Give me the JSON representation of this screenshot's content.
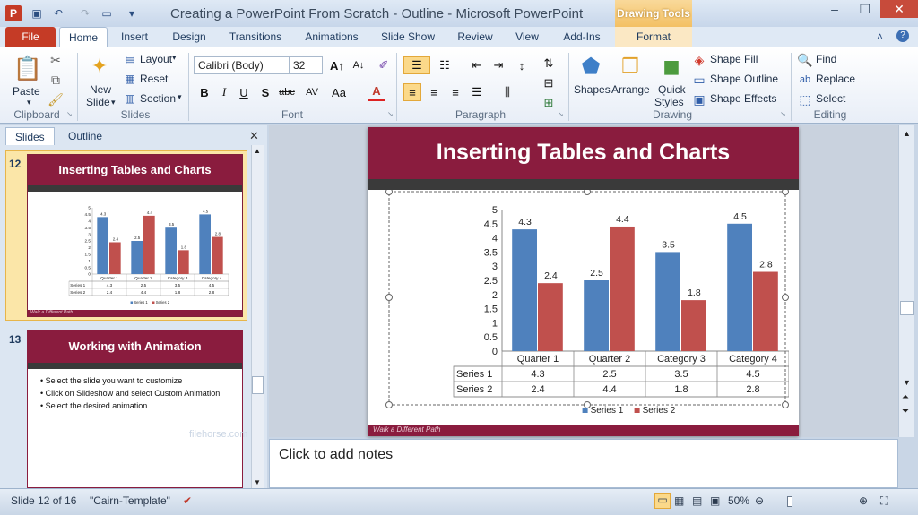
{
  "window": {
    "title": "Creating a PowerPoint From Scratch - Outline - Microsoft PowerPoint"
  },
  "context_tab": {
    "label": "Drawing Tools"
  },
  "tabs": [
    "File",
    "Home",
    "Insert",
    "Design",
    "Transitions",
    "Animations",
    "Slide Show",
    "Review",
    "View",
    "Add-Ins",
    "Format"
  ],
  "ribbon": {
    "clipboard": {
      "paste": "Paste",
      "label": "Clipboard"
    },
    "slides": {
      "new_slide_1": "New",
      "new_slide_2": "Slide",
      "layout": "Layout",
      "reset": "Reset",
      "section": "Section",
      "label": "Slides"
    },
    "font": {
      "name": "Calibri (Body)",
      "size": "32",
      "label": "Font"
    },
    "paragraph": {
      "label": "Paragraph"
    },
    "drawing": {
      "shapes": "Shapes",
      "arrange": "Arrange",
      "quick_styles_1": "Quick",
      "quick_styles_2": "Styles",
      "shape_fill": "Shape Fill",
      "shape_outline": "Shape Outline",
      "shape_effects": "Shape Effects",
      "label": "Drawing"
    },
    "editing": {
      "find": "Find",
      "replace": "Replace",
      "select": "Select",
      "label": "Editing"
    }
  },
  "pane": {
    "tabs": [
      "Slides",
      "Outline"
    ],
    "slide12": {
      "num": "12",
      "title": "Inserting Tables and Charts",
      "footer": "Walk a Different Path"
    },
    "slide13": {
      "num": "13",
      "title": "Working with Animation",
      "bullets": [
        "Select the slide you want to customize",
        "Click on Slideshow and select Custom Animation",
        "Select the desired animation"
      ]
    }
  },
  "slide": {
    "title": "Inserting Tables and Charts",
    "footer": "Walk a Different Path"
  },
  "notes": {
    "placeholder": "Click to add notes"
  },
  "status": {
    "slide": "Slide 12 of 16",
    "theme": "\"Cairn-Template\"",
    "zoom": "50%"
  },
  "watermark": "filehorse.com",
  "chart_data": {
    "type": "bar",
    "categories": [
      "Quarter 1",
      "Quarter 2",
      "Category 3",
      "Category 4"
    ],
    "series": [
      {
        "name": "Series 1",
        "values": [
          4.3,
          2.5,
          3.5,
          4.5
        ],
        "color": "#4f81bd"
      },
      {
        "name": "Series 2",
        "values": [
          2.4,
          4.4,
          1.8,
          2.8
        ],
        "color": "#c0504d"
      }
    ],
    "yticks": [
      "0",
      "0.5",
      "1",
      "1.5",
      "2",
      "2.5",
      "3",
      "3.5",
      "4",
      "4.5",
      "5"
    ],
    "ylim": [
      0,
      5
    ],
    "legend": "bottom"
  }
}
